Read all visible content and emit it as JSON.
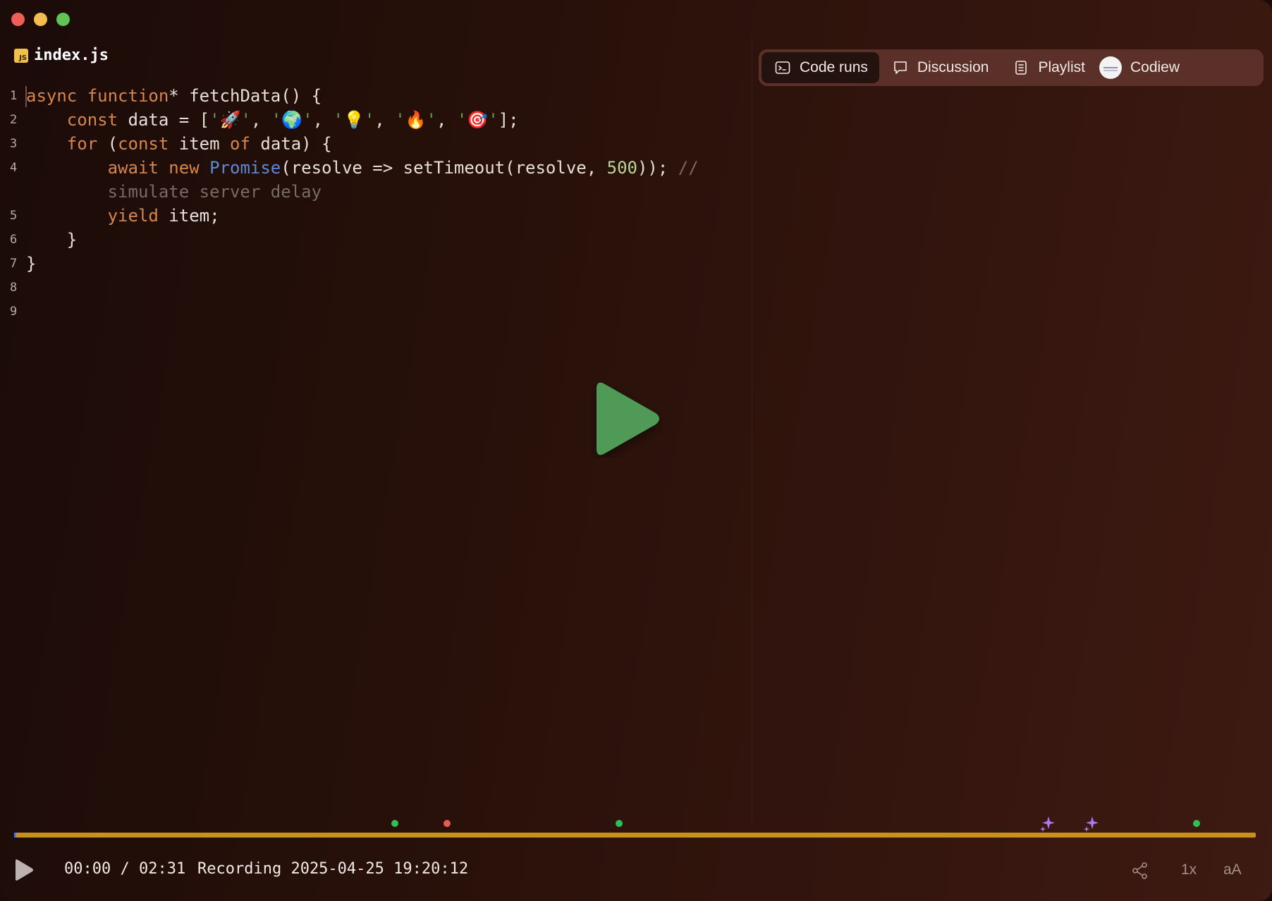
{
  "file": {
    "name": "index.js",
    "badge": "JS"
  },
  "code": {
    "line_numbers": [
      "1",
      "2",
      "3",
      "4",
      "5",
      "6",
      "7",
      "8",
      "9"
    ]
  },
  "panel_tabs": [
    {
      "label": "Code runs",
      "icon": "terminal-icon",
      "active": true
    },
    {
      "label": "Discussion",
      "icon": "comment-icon",
      "active": false
    },
    {
      "label": "Playlist",
      "icon": "document-list-icon",
      "active": false
    },
    {
      "label": "Codiew",
      "icon": "avatar",
      "active": false
    }
  ],
  "player": {
    "current_time": "00:00",
    "separator": "/",
    "duration": "02:31",
    "recording_title": "Recording 2025-04-25 19:20:12",
    "speed": "1x",
    "font_size_label": "aA",
    "progress_fraction": 0.0
  },
  "timeline_markers": [
    {
      "type": "green-dot",
      "color": "#2fbf55"
    },
    {
      "type": "red-dot",
      "color": "#e85a55"
    },
    {
      "type": "green-dot",
      "color": "#2fbf55"
    },
    {
      "type": "sparkle",
      "color": "#b079ea"
    },
    {
      "type": "sparkle",
      "color": "#b079ea"
    },
    {
      "type": "green-dot",
      "color": "#2fbf55"
    }
  ],
  "colors": {
    "accent_play": "#4f9a57",
    "timeline": "#c8901f",
    "keyword": "#d6864c",
    "class_name": "#5b8bd2",
    "number": "#b9d597",
    "comment": "#776a66"
  }
}
